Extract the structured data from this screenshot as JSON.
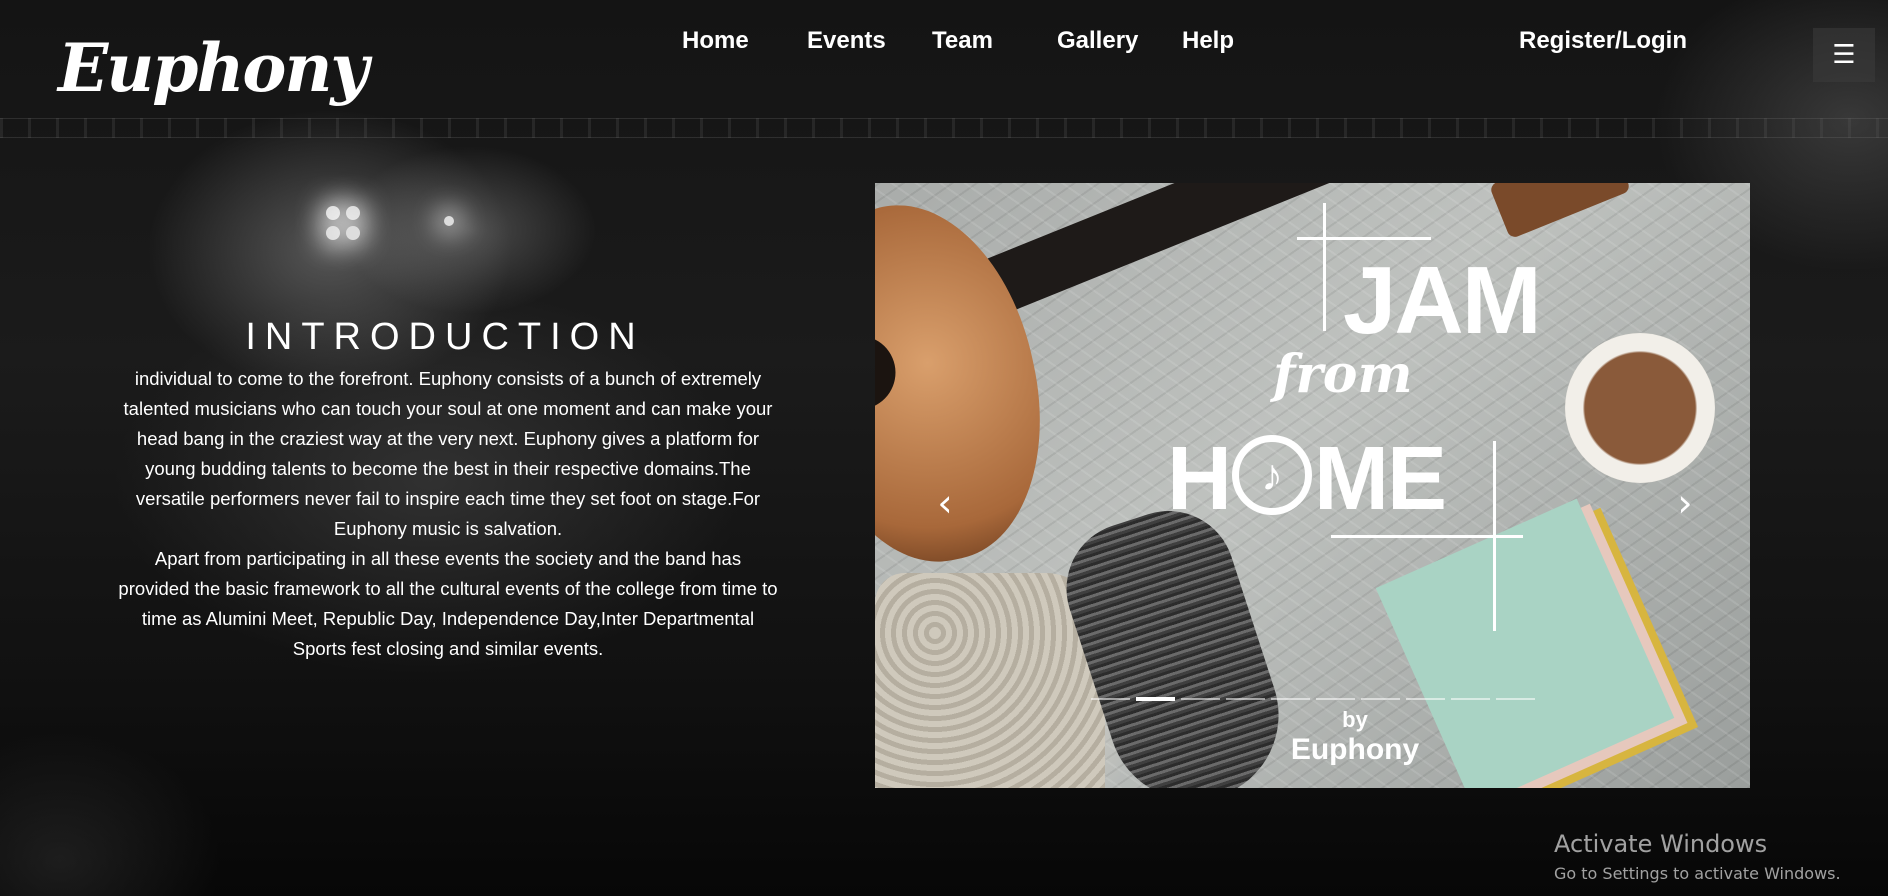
{
  "brand": {
    "logo_text": "Euphony"
  },
  "nav": {
    "items": [
      "Home",
      "Events",
      "Team",
      "Gallery",
      "Help"
    ],
    "register_login": "Register/Login",
    "menu_icon": "hamburger-icon"
  },
  "intro": {
    "title": "INTRODUCTION",
    "paragraphs": [
      "individual to come to the forefront. Euphony consists of a bunch of extremely talented musicians who can touch your soul at one moment and can make your head bang in the craziest way at the very next. Euphony gives a platform for young budding talents to become the best in their respective domains.The versatile performers never fail to inspire each time they set foot on stage.For Euphony music is salvation.",
      "Apart from participating in all these events the society and the band has provided the basic framework to all the cultural events of the college from time to time as Alumini Meet, Republic Day, Independence Day,Inter Departmental Sports fest closing and similar events."
    ]
  },
  "carousel": {
    "slide_title_1": "JAM",
    "slide_title_2": "from",
    "slide_title_3a": "H",
    "slide_title_3b": "ME",
    "slide_by": "by",
    "slide_brand": "Euphony",
    "slide_count": 10,
    "active_slide": 2,
    "prev_icon": "chevron-left-icon",
    "next_icon": "chevron-right-icon"
  },
  "system_watermark": {
    "title": "Activate Windows",
    "subtitle": "Go to Settings to activate Windows."
  }
}
